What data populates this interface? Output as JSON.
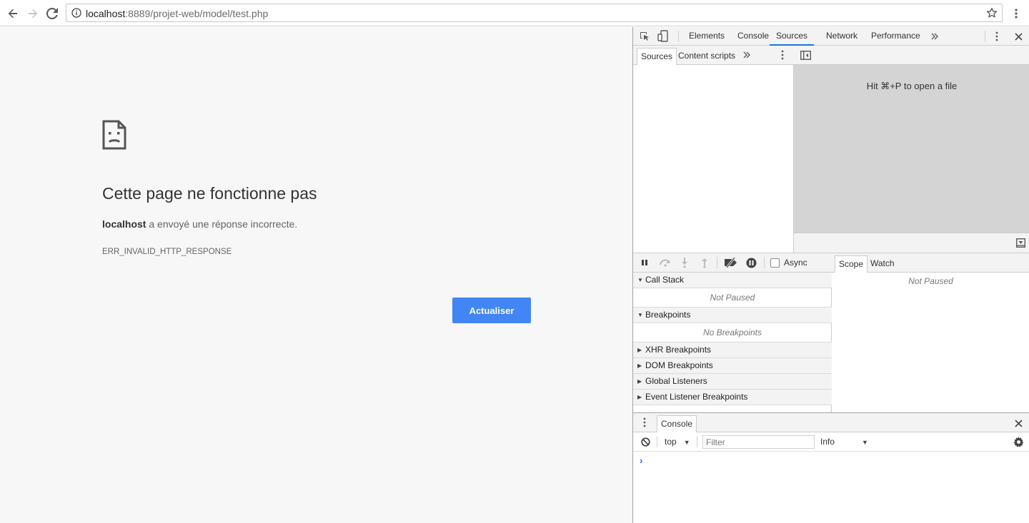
{
  "browser": {
    "url_host": "localhost",
    "url_rest": ":8889/projet-web/model/test.php"
  },
  "error_page": {
    "title": "Cette page ne fonctionne pas",
    "desc_host": "localhost",
    "desc_rest": " a envoyé une réponse incorrecte.",
    "code": "ERR_INVALID_HTTP_RESPONSE",
    "reload_label": "Actualiser",
    "accent_color": "#4285f4"
  },
  "devtools": {
    "tabs": [
      "Elements",
      "Console",
      "Sources",
      "Network",
      "Performance"
    ],
    "active_tab": "Sources",
    "navigator_tabs": [
      "Sources",
      "Content scripts"
    ],
    "editor_hint": "Hit ⌘+P to open a file",
    "async_label": "Async",
    "sections": {
      "call_stack": "Call Stack",
      "call_stack_empty": "Not Paused",
      "breakpoints": "Breakpoints",
      "breakpoints_empty": "No Breakpoints",
      "xhr": "XHR Breakpoints",
      "dom": "DOM Breakpoints",
      "global": "Global Listeners",
      "event": "Event Listener Breakpoints"
    },
    "sidebar_tabs": [
      "Scope",
      "Watch"
    ],
    "sidebar_empty": "Not Paused",
    "drawer_tab": "Console",
    "console": {
      "context": "top",
      "filter_placeholder": "Filter",
      "level": "Info",
      "prompt": "›"
    }
  }
}
